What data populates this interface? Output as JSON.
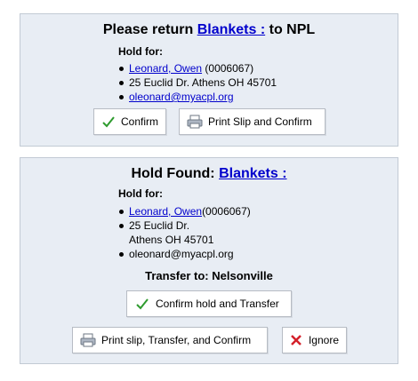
{
  "notice": {
    "title_prefix": "Please return",
    "item_link": "Blankets :",
    "title_suffix": "to NPL",
    "hold_for_label": "Hold for:",
    "patron_name": "Leonard, Owen",
    "patron_id": "(0006067)",
    "address": "25 Euclid Dr. Athens OH 45701",
    "email": "oleonard@myacpl.org",
    "confirm_label": "Confirm",
    "print_confirm_label": "Print Slip and Confirm"
  },
  "hold": {
    "title_prefix": "Hold Found:",
    "item_link": "Blankets :",
    "hold_for_label": "Hold for:",
    "patron_name": "Leonard, Owen",
    "patron_id": "(0006067)",
    "address_line1": "25 Euclid Dr.",
    "address_line2": "Athens OH 45701",
    "email": "oleonard@myacpl.org",
    "transfer_text": "Transfer to: Nelsonville",
    "confirm_transfer_label": "Confirm hold and Transfer",
    "print_transfer_label": "Print slip, Transfer, and Confirm",
    "ignore_label": "Ignore"
  },
  "icons": {
    "confirm": "check-icon",
    "print": "printer-icon",
    "ignore": "close-icon"
  },
  "colors": {
    "panel_bg": "#e8edf4",
    "link": "#0000cc",
    "check": "#2e9b2e",
    "ignore": "#d4202a"
  }
}
